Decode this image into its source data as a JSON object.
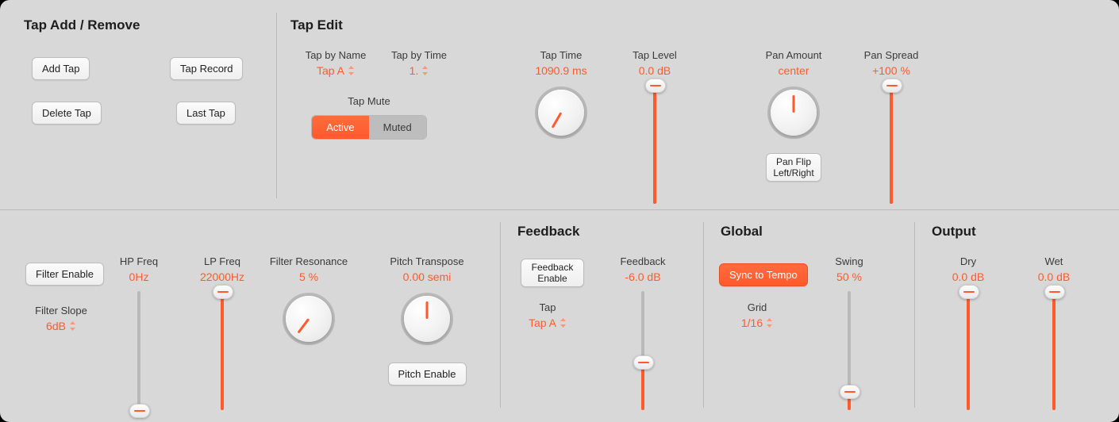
{
  "tap_add": {
    "title": "Tap Add / Remove",
    "add": "Add Tap",
    "record": "Tap Record",
    "delete": "Delete Tap",
    "last": "Last Tap"
  },
  "tap_edit": {
    "title": "Tap Edit",
    "by_name": {
      "label": "Tap by Name",
      "value": "Tap A"
    },
    "by_time": {
      "label": "Tap by Time",
      "value": "1."
    },
    "mute": {
      "label": "Tap Mute",
      "active": "Active",
      "muted": "Muted",
      "state": "Active"
    },
    "tap_time": {
      "label": "Tap Time",
      "value": "1090.9 ms",
      "angle": 210,
      "arc_start": 225,
      "arc_end": 210
    },
    "tap_level": {
      "label": "Tap Level",
      "value": "0.0 dB",
      "pos": 0.0,
      "fill_from": 0.0,
      "fill_to": 1.0
    },
    "pan_amount": {
      "label": "Pan Amount",
      "value": "center",
      "angle": 0
    },
    "pan_flip": "Pan Flip Left/Right",
    "pan_spread": {
      "label": "Pan Spread",
      "value": "+100 %",
      "pos": 0.0,
      "fill_from": 0.0,
      "fill_to": 1.0
    }
  },
  "filter": {
    "enable": "Filter Enable",
    "slope": {
      "label": "Filter Slope",
      "value": "6dB"
    },
    "hp": {
      "label": "HP Freq",
      "value": "0Hz",
      "pos": 1.0,
      "fill_from": 1.0,
      "fill_to": 1.0
    },
    "lp": {
      "label": "LP Freq",
      "value": "22000Hz",
      "pos": 0.0,
      "fill_from": 0.0,
      "fill_to": 1.0
    },
    "res": {
      "label": "Filter Resonance",
      "value": "5 %",
      "angle": 217,
      "arc_start": 225,
      "arc_end": 217
    },
    "pitch": {
      "label": "Pitch Transpose",
      "value": "0.00 semi",
      "angle": 0
    },
    "pitch_enable": "Pitch Enable"
  },
  "feedback": {
    "title": "Feedback",
    "enable": "Feedback Enable",
    "tap": {
      "label": "Tap",
      "value": "Tap A"
    },
    "amount": {
      "label": "Feedback",
      "value": "-6.0 dB",
      "pos": 0.59,
      "fill_from": 0.59,
      "fill_to": 1.0
    }
  },
  "global": {
    "title": "Global",
    "sync": "Sync to Tempo",
    "grid": {
      "label": "Grid",
      "value": "1/16"
    },
    "swing": {
      "label": "Swing",
      "value": "50 %",
      "pos": 0.84,
      "fill_from": 0.84,
      "fill_to": 1.0
    }
  },
  "output": {
    "title": "Output",
    "dry": {
      "label": "Dry",
      "value": "0.0 dB",
      "pos": 0.0,
      "fill_from": 0.0,
      "fill_to": 1.0
    },
    "wet": {
      "label": "Wet",
      "value": "0.0 dB",
      "pos": 0.0,
      "fill_from": 0.0,
      "fill_to": 1.0
    }
  }
}
